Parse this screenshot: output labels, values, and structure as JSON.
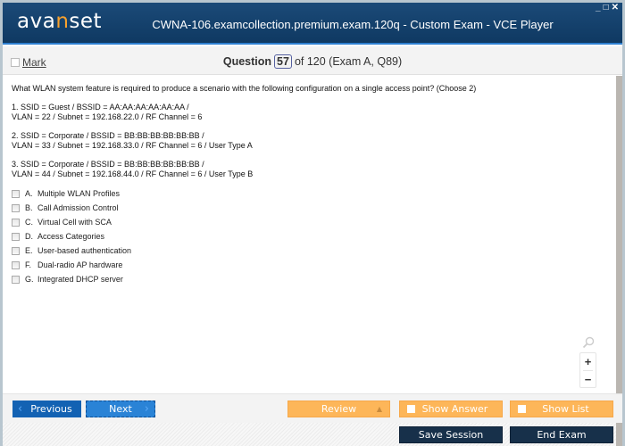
{
  "window": {
    "logo": {
      "pre": "ava",
      "accent": "n",
      "post": "set"
    },
    "title": "CWNA-106.examcollection.premium.exam.120q - Custom Exam - VCE Player",
    "controls": {
      "minimize": "_",
      "maximize": "□",
      "close": "✕"
    }
  },
  "question_bar": {
    "mark_label": "Mark",
    "question_label": "Question",
    "current": "57",
    "of_text": "of 120 (Exam A, Q89)"
  },
  "question": {
    "text": "What WLAN system feature is required to produce a scenario with the following configuration on a single access point? (Choose 2)",
    "configs": [
      {
        "line1": "1.  SSID = Guest / BSSID = AA:AA:AA:AA:AA:AA /",
        "line2": "VLAN = 22 / Subnet = 192.168.22.0 / RF Channel = 6"
      },
      {
        "line1": "2.  SSID = Corporate / BSSID = BB:BB:BB:BB:BB:BB /",
        "line2": "VLAN = 33 / Subnet = 192.168.33.0 / RF Channel = 6 / User Type A"
      },
      {
        "line1": "3.  SSID = Corporate / BSSID = BB:BB:BB:BB:BB:BB /",
        "line2": "VLAN = 44 / Subnet = 192.168.44.0 / RF Channel = 6 / User Type B"
      }
    ],
    "options": [
      {
        "letter": "A.",
        "text": "Multiple WLAN Profiles",
        "checked": false
      },
      {
        "letter": "B.",
        "text": "Call Admission Control",
        "checked": false
      },
      {
        "letter": "C.",
        "text": "Virtual Cell with SCA",
        "checked": false
      },
      {
        "letter": "D.",
        "text": "Access Categories",
        "checked": false
      },
      {
        "letter": "E.",
        "text": "User-based authentication",
        "checked": false
      },
      {
        "letter": "F.",
        "text": "Dual-radio AP hardware",
        "checked": false
      },
      {
        "letter": "G.",
        "text": "Integrated DHCP server",
        "checked": false
      }
    ]
  },
  "zoom": {
    "search_icon": "magnifier-icon",
    "in": "+",
    "out": "−"
  },
  "nav": {
    "previous": "Previous",
    "next": "Next",
    "review": "Review",
    "show_answer": "Show Answer",
    "show_list": "Show List",
    "save_session": "Save Session",
    "end_exam": "End Exam"
  },
  "colors": {
    "titlebar": "#0f3962",
    "accent_orange": "#fdb659",
    "nav_blue": "#1362b3",
    "dark_button": "#17304a"
  }
}
